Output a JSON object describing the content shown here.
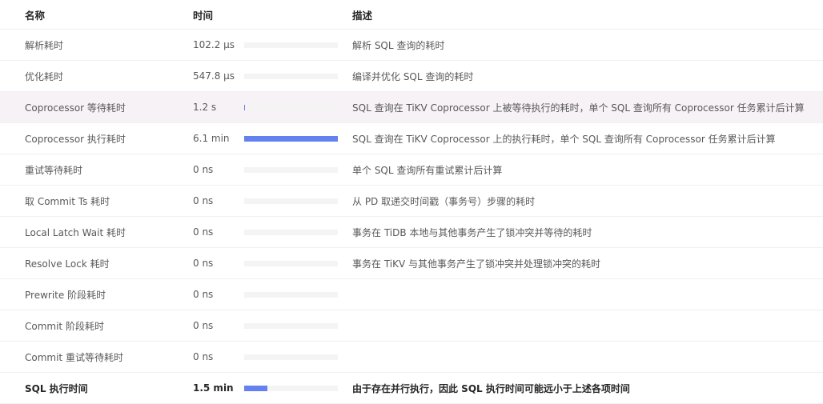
{
  "table": {
    "headers": {
      "name": "名称",
      "time": "时间",
      "desc": "描述"
    },
    "bar_color": "#6382ef",
    "rows": [
      {
        "name": "解析耗时",
        "value": "102.2 µs",
        "fraction": 0.0,
        "desc": "解析 SQL 查询的耗时",
        "highlight": false,
        "bold": false
      },
      {
        "name": "优化耗时",
        "value": "547.8 µs",
        "fraction": 0.0,
        "desc": "编译并优化 SQL 查询的耗时",
        "highlight": false,
        "bold": false
      },
      {
        "name": "Coprocessor 等待耗时",
        "value": "1.2 s",
        "fraction": 0.0033,
        "desc": "SQL 查询在 TiKV Coprocessor 上被等待执行的耗时，单个 SQL 查询所有 Coprocessor 任务累计后计算",
        "highlight": true,
        "bold": false
      },
      {
        "name": "Coprocessor 执行耗时",
        "value": "6.1 min",
        "fraction": 1.0,
        "desc": "SQL 查询在 TiKV Coprocessor 上的执行耗时，单个 SQL 查询所有 Coprocessor 任务累计后计算",
        "highlight": false,
        "bold": false
      },
      {
        "name": "重试等待耗时",
        "value": "0 ns",
        "fraction": 0.0,
        "desc": "单个 SQL 查询所有重试累计后计算",
        "highlight": false,
        "bold": false
      },
      {
        "name": "取 Commit Ts 耗时",
        "value": "0 ns",
        "fraction": 0.0,
        "desc": "从 PD 取递交时间戳（事务号）步骤的耗时",
        "highlight": false,
        "bold": false
      },
      {
        "name": "Local Latch Wait 耗时",
        "value": "0 ns",
        "fraction": 0.0,
        "desc": "事务在 TiDB 本地与其他事务产生了锁冲突并等待的耗时",
        "highlight": false,
        "bold": false
      },
      {
        "name": "Resolve Lock 耗时",
        "value": "0 ns",
        "fraction": 0.0,
        "desc": "事务在 TiKV 与其他事务产生了锁冲突并处理锁冲突的耗时",
        "highlight": false,
        "bold": false
      },
      {
        "name": "Prewrite 阶段耗时",
        "value": "0 ns",
        "fraction": 0.0,
        "desc": "",
        "highlight": false,
        "bold": false
      },
      {
        "name": "Commit 阶段耗时",
        "value": "0 ns",
        "fraction": 0.0,
        "desc": "",
        "highlight": false,
        "bold": false
      },
      {
        "name": "Commit 重试等待耗时",
        "value": "0 ns",
        "fraction": 0.0,
        "desc": "",
        "highlight": false,
        "bold": false
      },
      {
        "name": "SQL 执行时间",
        "value": "1.5 min",
        "fraction": 0.246,
        "desc": "由于存在并行执行，因此 SQL 执行时间可能远小于上述各项时间",
        "highlight": false,
        "bold": true
      }
    ]
  }
}
